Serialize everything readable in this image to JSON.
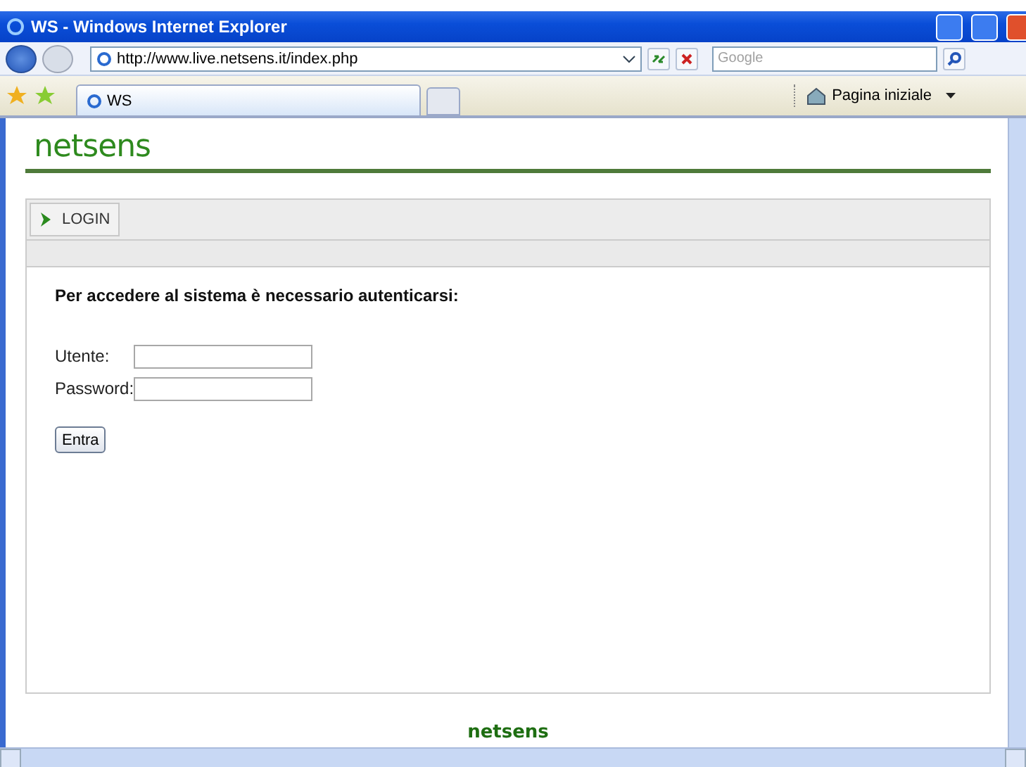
{
  "window": {
    "title": "WS - Windows Internet Explorer"
  },
  "address_bar": {
    "url": "http://www.live.netsens.it/index.php"
  },
  "search": {
    "placeholder": "Google"
  },
  "tabs": [
    {
      "label": "WS",
      "selected": true
    }
  ],
  "home_button": {
    "label": "Pagina iniziale"
  },
  "page": {
    "logo": "netsens",
    "menu": [
      {
        "label": "LOGIN"
      }
    ],
    "heading": "Per accedere al sistema è necessario autenticarsi:",
    "fields": [
      {
        "label": "Utente:"
      },
      {
        "label": "Password:"
      }
    ],
    "submit": "Entra",
    "footer_logo": "netsens"
  }
}
